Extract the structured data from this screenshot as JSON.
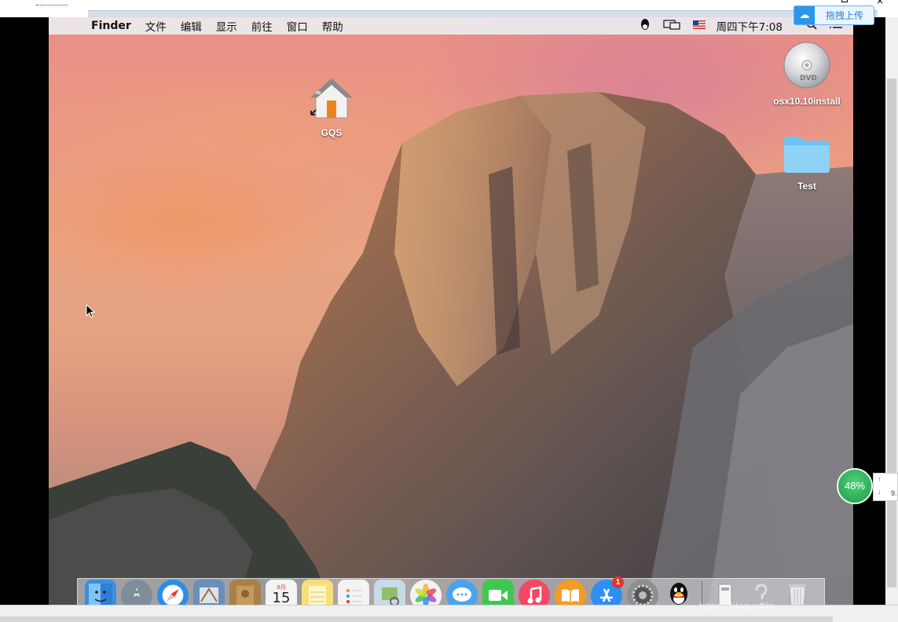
{
  "menubar": {
    "app_name": "Finder",
    "items": [
      "文件",
      "编辑",
      "显示",
      "前往",
      "窗口",
      "帮助"
    ],
    "clock": "周四下午7:08"
  },
  "upload_button": {
    "label": "拖拽上传"
  },
  "desktop_icons": {
    "home": "GQS",
    "dvd": "osx10.10install",
    "folder": "Test"
  },
  "dock": {
    "items": [
      {
        "name": "finder-icon",
        "color": "#3b8fe0"
      },
      {
        "name": "launchpad-icon",
        "color": "#7f8c99"
      },
      {
        "name": "safari-icon",
        "color": "#2a8ee6"
      },
      {
        "name": "mail-icon",
        "color": "#6b8fb8"
      },
      {
        "name": "contacts-icon",
        "color": "#a8804a"
      },
      {
        "name": "calendar-icon",
        "color": "#f4f4f4"
      },
      {
        "name": "notes-icon",
        "color": "#f7e07a"
      },
      {
        "name": "reminders-icon",
        "color": "#f3f3f3"
      },
      {
        "name": "preview-icon",
        "color": "#c9d9e8"
      },
      {
        "name": "photos-icon",
        "color": "#f2f2f2"
      },
      {
        "name": "messages-icon",
        "color": "#4aa3f0"
      },
      {
        "name": "facetime-icon",
        "color": "#3fc84f"
      },
      {
        "name": "itunes-icon",
        "color": "#f24865"
      },
      {
        "name": "ibooks-icon",
        "color": "#f59b24"
      },
      {
        "name": "app-store-icon",
        "color": "#2e8ff0"
      },
      {
        "name": "system-preferences-icon",
        "color": "#8e8e93"
      },
      {
        "name": "qq-icon",
        "color": "#1b1b1b"
      }
    ],
    "calendar_day": "15",
    "calendar_month": "8月",
    "app_store_badge": "1"
  },
  "speed_widget": {
    "percent": "48%",
    "value": "9."
  },
  "watermark": "https://blog.csdn"
}
